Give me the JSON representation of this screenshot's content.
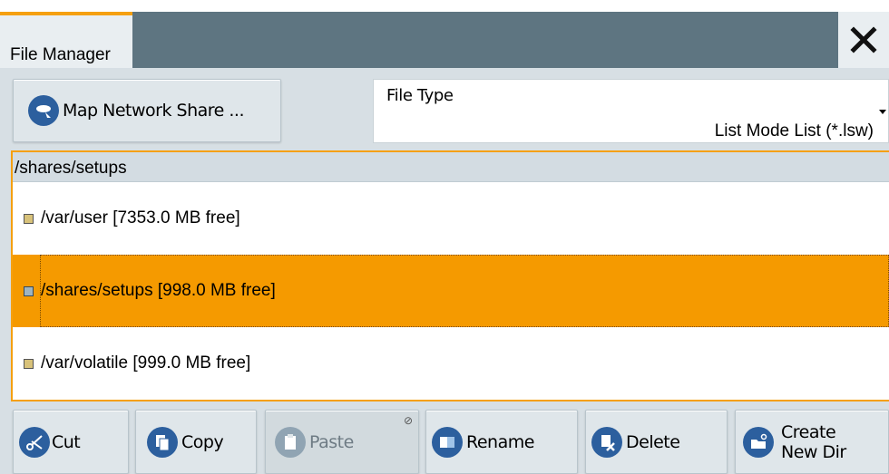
{
  "window": {
    "tab_title": "File Manager",
    "close_glyph": "✕"
  },
  "toolbar": {
    "map_share_label": "Map Network Share ..."
  },
  "file_type": {
    "label": "File Type",
    "value": "List Mode List (*.lsw)"
  },
  "browser": {
    "current_path": "/shares/setups",
    "items": [
      {
        "label": "/var/user  [7353.0 MB free]",
        "selected": false
      },
      {
        "label": "/shares/setups  [998.0 MB free]",
        "selected": true
      },
      {
        "label": "/var/volatile  [999.0 MB free]",
        "selected": false
      }
    ]
  },
  "actions": {
    "cut": "Cut",
    "copy": "Copy",
    "paste": "Paste",
    "rename": "Rename",
    "delete": "Delete",
    "create_line1": "Create",
    "create_line2": "New Dir",
    "paste_disabled_glyph": "⊘"
  },
  "colors": {
    "accent": "#f5a010",
    "selection": "#f59a00",
    "titlebar": "#5e7581",
    "icon_blue": "#2c5f9e"
  }
}
